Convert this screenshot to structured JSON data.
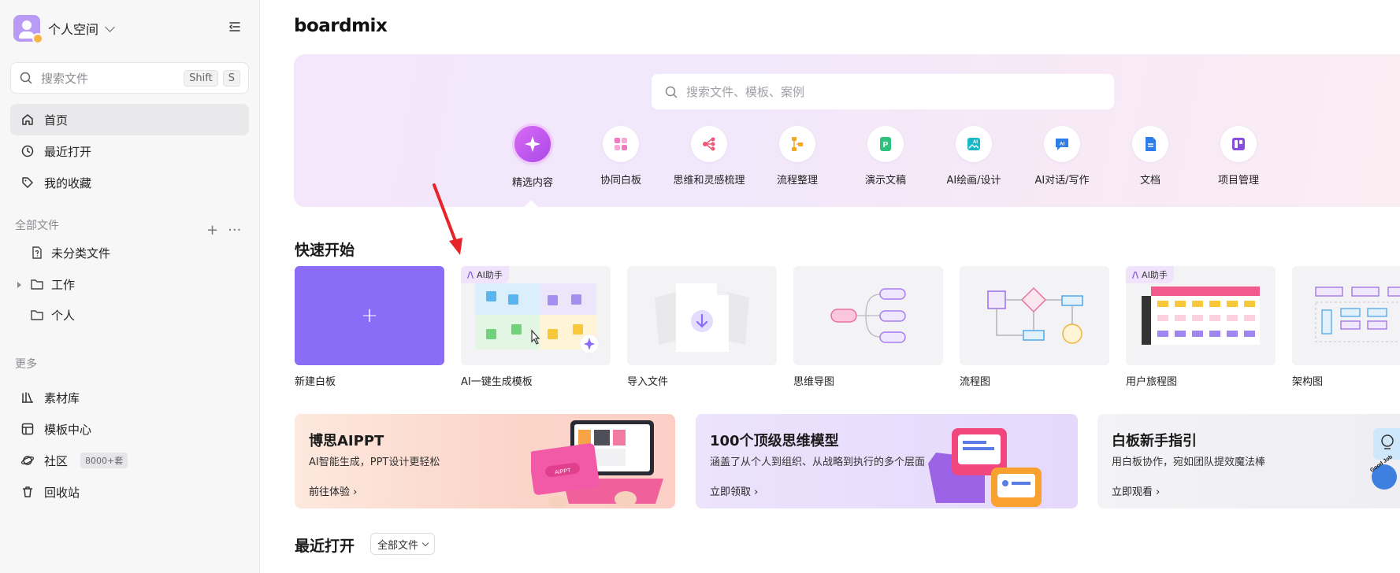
{
  "workspace": {
    "name": "个人空间"
  },
  "search": {
    "placeholder": "搜索文件",
    "shortcut_1": "Shift",
    "shortcut_2": "S"
  },
  "nav": {
    "home": "首页",
    "recent": "最近打开",
    "favorites": "我的收藏"
  },
  "files": {
    "header": "全部文件",
    "items": [
      {
        "label": "未分类文件"
      },
      {
        "label": "工作"
      },
      {
        "label": "个人"
      }
    ]
  },
  "more": {
    "header": "更多",
    "items": [
      {
        "label": "素材库"
      },
      {
        "label": "模板中心"
      },
      {
        "label": "社区",
        "badge": "8000+套"
      },
      {
        "label": "回收站"
      }
    ]
  },
  "main": {
    "logo": "boardmix",
    "search_placeholder": "搜索文件、模板、案例",
    "categories": [
      {
        "label": "精选内容",
        "icon": "sparkle-icon",
        "color": "#b24ee9"
      },
      {
        "label": "协同白板",
        "icon": "whiteboard-icon",
        "color": "#f07ac0"
      },
      {
        "label": "思维和灵感梳理",
        "icon": "mindmap-icon",
        "color": "#f05a7a"
      },
      {
        "label": "流程整理",
        "icon": "flowchart-icon",
        "color": "#f5a623"
      },
      {
        "label": "演示文稿",
        "icon": "presentation-icon",
        "color": "#2ec27e"
      },
      {
        "label": "AI绘画/设计",
        "icon": "ai-paint-icon",
        "color": "#19b8c8"
      },
      {
        "label": "AI对话/写作",
        "icon": "ai-chat-icon",
        "color": "#2f7de6"
      },
      {
        "label": "文档",
        "icon": "document-icon",
        "color": "#2f7de6"
      },
      {
        "label": "项目管理",
        "icon": "project-icon",
        "color": "#8a4be0"
      }
    ],
    "quick_start": {
      "title": "快速开始",
      "ai_tag": "AI助手",
      "cards": [
        {
          "label": "新建白板"
        },
        {
          "label": "AI一键生成模板"
        },
        {
          "label": "导入文件"
        },
        {
          "label": "思维导图"
        },
        {
          "label": "流程图"
        },
        {
          "label": "用户旅程图"
        },
        {
          "label": "架构图"
        }
      ]
    },
    "promos": [
      {
        "title": "博思AIPPT",
        "subtitle": "AI智能生成，PPT设计更轻松",
        "link": "前往体验"
      },
      {
        "title": "100个顶级思维模型",
        "subtitle": "涵盖了从个人到组织、从战略到执行的多个层面",
        "link": "立即领取"
      },
      {
        "title": "白板新手指引",
        "subtitle": "用白板协作，宛如团队提效魔法棒",
        "link": "立即观看"
      }
    ],
    "recent": {
      "title": "最近打开",
      "filter": "全部文件"
    },
    "promo_card_text": "AIPPT",
    "sticker_text": "Good Job"
  },
  "colors": {
    "accent": "#8b6cf7",
    "annotation_arrow": "#e5252a"
  }
}
